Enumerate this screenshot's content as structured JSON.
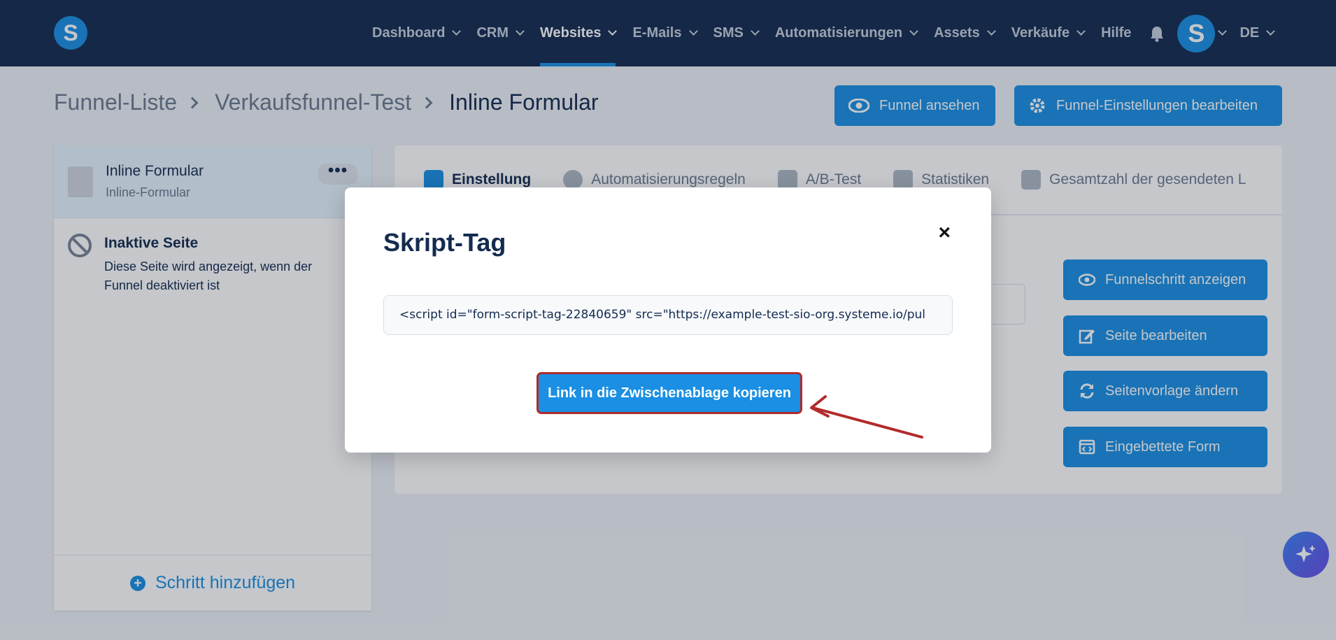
{
  "nav": {
    "logo_letter": "S",
    "items": [
      {
        "label": "Dashboard"
      },
      {
        "label": "CRM"
      },
      {
        "label": "Websites",
        "active": true
      },
      {
        "label": "E-Mails"
      },
      {
        "label": "SMS"
      },
      {
        "label": "Automatisierungen"
      },
      {
        "label": "Assets"
      },
      {
        "label": "Verkäufe"
      }
    ],
    "help_label": "Hilfe",
    "avatar_letter": "S",
    "language": "DE"
  },
  "breadcrumb": {
    "items": [
      "Funnel-Liste",
      "Verkaufsfunnel-Test",
      "Inline Formular"
    ]
  },
  "header_buttons": {
    "view_funnel": "Funnel ansehen",
    "edit_settings": "Funnel-Einstellungen bearbeiten"
  },
  "sidebar": {
    "step_title": "Inline Formular",
    "step_subtitle": "Inline-Formular",
    "more_label": "•••",
    "inactive_title": "Inaktive Seite",
    "inactive_desc": "Diese Seite wird angezeigt, wenn der Funnel deaktiviert ist",
    "add_step": "Schritt hinzufügen"
  },
  "tabs": [
    {
      "label": "Einstellung",
      "active": true
    },
    {
      "label": "Automatisierungsregeln"
    },
    {
      "label": "A/B-Test"
    },
    {
      "label": "Statistiken"
    },
    {
      "label": "Gesamtzahl der gesendeten L"
    }
  ],
  "actions": {
    "show_step": "Funnelschritt anzeigen",
    "edit_page": "Seite bearbeiten",
    "change_template": "Seitenvorlage ändern",
    "embedded_form": "Eingebettete Form"
  },
  "modal": {
    "title": "Skript-Tag",
    "close": "×",
    "script_value": "<script id=\"form-script-tag-22840659\" src=\"https://example-test-sio-org.systeme.io/pul",
    "copy_button": "Link in die Zwischenablage kopieren"
  },
  "colors": {
    "nav_bg": "#142b4f",
    "accent": "#1a8fe3",
    "highlight_red": "#b22b2b"
  }
}
